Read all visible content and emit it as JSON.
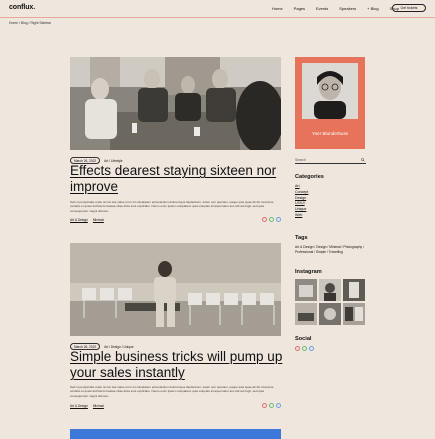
{
  "header": {
    "logo": "conflux.",
    "nav": [
      "Home",
      "Pages",
      "Events",
      "Speakers",
      "+ Blog",
      "Shop"
    ],
    "cta": "Get tickets"
  },
  "breadcrumb": "Home / Blog / Right Sidebar",
  "posts": [
    {
      "date": "March 26, 2022",
      "categories_meta": "Art / Lifestyle",
      "title": "Effects dearest staying sixteen nor improve",
      "excerpt": "Sed ut perspiciatis unde omnis iste natus error sit voluptatem accusantium doloremque laudantium, totam rem aperiam, eaque ipsa quae ab illo inventore veritatis et quasi architecto beatae vitae dicta sunt explicabo. Nemo enim ipsam voluptatem quia voluptas sit aspernatur aut odit aut fugit, sed quia consequuntur magni dolores...",
      "foot_cats": [
        "Art & Design",
        "Minimal"
      ]
    },
    {
      "date": "March 26, 2022",
      "categories_meta": "Art / Design / Unique",
      "title": "Simple business tricks will pump up your sales instantly",
      "excerpt": "Sed ut perspiciatis unde omnis iste natus error sit voluptatem accusantium doloremque laudantium, totam rem aperiam, eaque ipsa quae ab illo inventore veritatis et quasi architecto beatae vitae dicta sunt explicabo. Nemo enim ipsam voluptatem quia voluptas sit aspernatur aut odit aut fugit, sed quia consequuntur magni dolores...",
      "foot_cats": [
        "Art & Design",
        "Minimal"
      ]
    }
  ],
  "sidebar": {
    "author_name": "Yoer Blunderbuss",
    "search_placeholder": "Search",
    "categories_heading": "Categories",
    "categories": [
      "Art",
      "Concept",
      "Design",
      "UX/UI",
      "Unique",
      "Web"
    ],
    "tags_heading": "Tags",
    "tags": "Art & Design / Design / Minimal / Photography / Professional / Simple / Travelling",
    "instagram_heading": "Instagram",
    "social_heading": "Social"
  },
  "colors": {
    "background": "#efe6dd",
    "accent": "#e8735b",
    "blue_block": "#3b78d8"
  }
}
